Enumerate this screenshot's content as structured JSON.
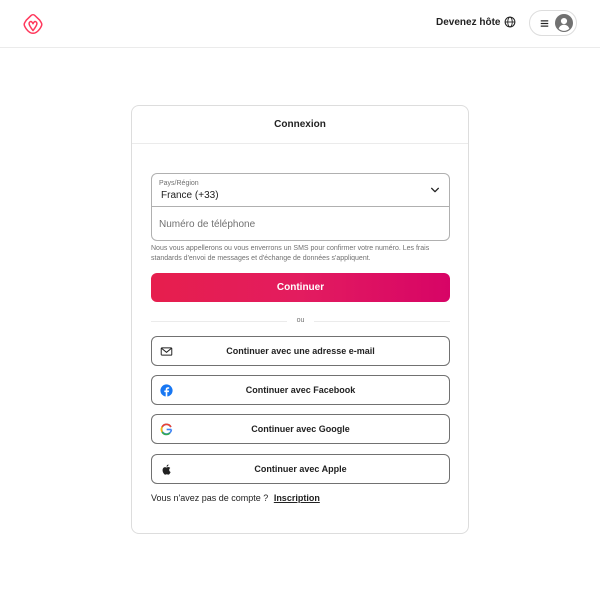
{
  "header": {
    "logo_icon": "airbnb-logo-icon",
    "brand_color": "#FF385C",
    "host_link": "Devenez hôte",
    "globe_icon": "globe-icon",
    "menu_icon": "hamburger-menu-icon",
    "avatar_icon": "user-avatar-icon"
  },
  "login": {
    "title": "Connexion",
    "country_label": "Pays/Région",
    "country_value": "France (+33)",
    "phone_placeholder": "Numéro de téléphone",
    "phone_value": "",
    "disclaimer": "Nous vous appellerons ou vous enverrons un SMS pour confirmer votre numéro. Les frais standards d'envoi de messages et d'échange de données s'appliquent.",
    "continue_label": "Continuer",
    "continue_color": "#E31C5F",
    "divider_text": "ou",
    "social": [
      {
        "label": "Continuer avec une adresse e-mail",
        "icon": "envelope-icon"
      },
      {
        "label": "Continuer avec Facebook",
        "icon": "facebook-icon"
      },
      {
        "label": "Continuer avec Google",
        "icon": "google-icon"
      },
      {
        "label": "Continuer avec Apple",
        "icon": "apple-icon"
      }
    ],
    "signup_prompt": "Vous n'avez pas de compte ?",
    "signup_link": "Inscription"
  }
}
